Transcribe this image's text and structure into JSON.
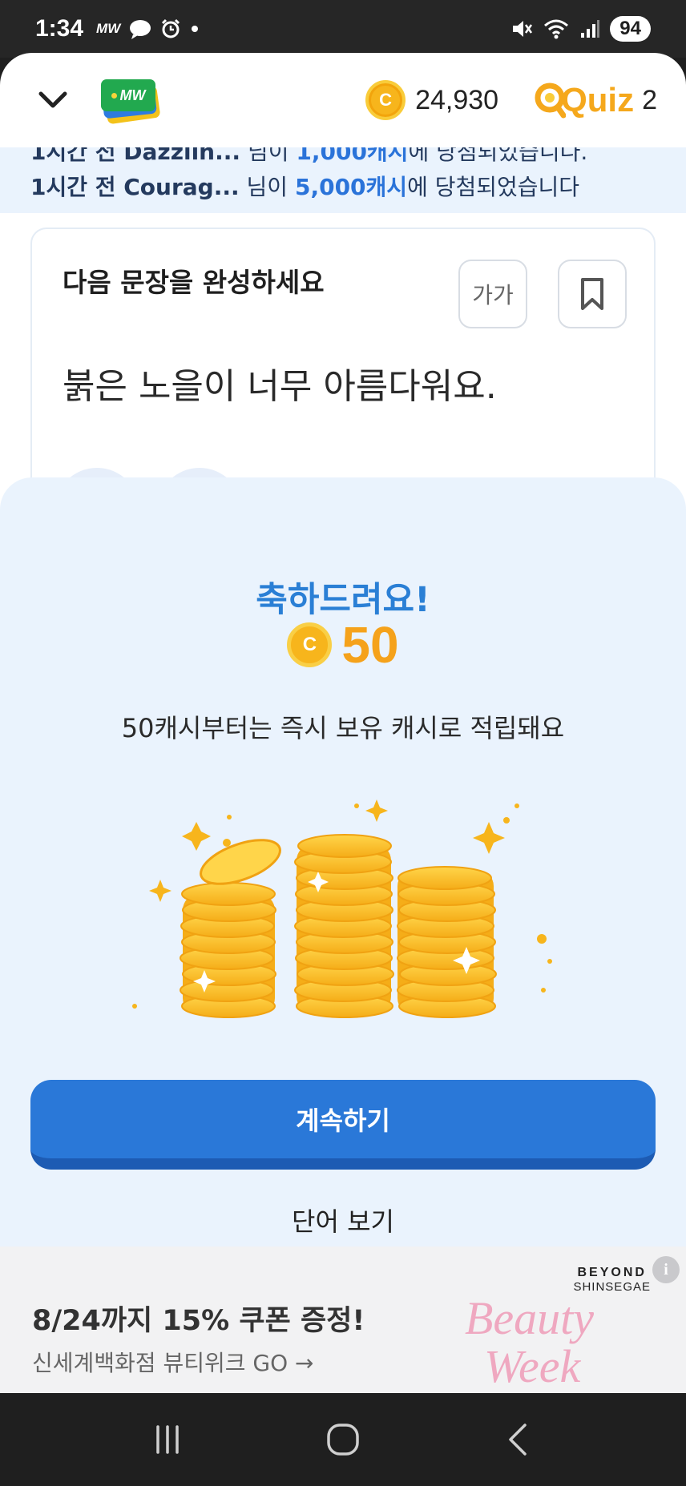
{
  "status_bar": {
    "time": "1:34",
    "mw_label": "MW",
    "battery": "94"
  },
  "header": {
    "logo_text": "MW",
    "cash": "24,930",
    "coin_symbol": "C",
    "quiz_label": "Quiz",
    "quiz_count": "2"
  },
  "ticker": {
    "line1_prefix": "1시간 전 Dazzlin...",
    "line1_mid": " 님이 ",
    "line1_amount": "1,000캐시",
    "line1_suffix": "에 당첨되었습니다.",
    "line2_prefix": "1시간 전 Courag...",
    "line2_mid": " 님이 ",
    "line2_amount": "5,000캐시",
    "line2_suffix": "에 당첨되었습니다"
  },
  "question": {
    "prompt": "다음 문장을 완성하세요",
    "font_size_label": "가가",
    "sentence": "붉은 노을이 너무 아름다워요."
  },
  "modal": {
    "title": "축하드려요!",
    "coin_symbol": "C",
    "amount": "50",
    "description": "50캐시부터는 즉시 보유 캐시로 적립돼요",
    "continue_label": "계속하기",
    "view_word_label": "단어 보기"
  },
  "ad": {
    "title": "8/24까지 15% 쿠폰 증정!",
    "subtitle": "신세계백화점 뷰티위크 GO →",
    "brand_line1": "BEYOND",
    "brand_line2": "SHINSEGAE",
    "visual_line1": "Beauty",
    "visual_line2": "Week",
    "info_icon": "i"
  },
  "colors": {
    "accent_blue": "#2a78d8",
    "coin_gold": "#f7b51c",
    "sheet_bg": "#eaf3fd"
  }
}
